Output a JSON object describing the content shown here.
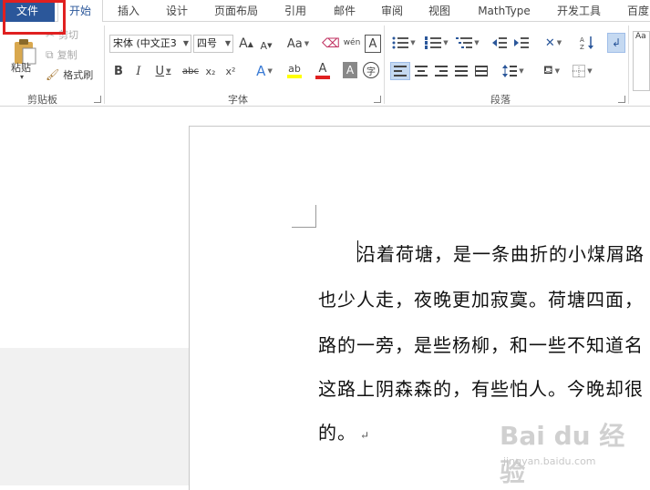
{
  "tabs": {
    "file": "文件",
    "home": "开始",
    "insert": "插入",
    "design": "设计",
    "layout": "页面布局",
    "references": "引用",
    "mailings": "邮件",
    "review": "审阅",
    "view": "视图",
    "mathtype": "MathType",
    "developer": "开发工具",
    "baidu": "百度"
  },
  "clipboard": {
    "paste": "粘贴",
    "cut": "剪切",
    "copy": "复制",
    "format_painter": "格式刷",
    "label": "剪贴板"
  },
  "font": {
    "font_name": "宋体 (中文正3",
    "font_size": "四号",
    "grow": "A",
    "shrink": "A",
    "change_case": "Aa",
    "phonetic": "wén",
    "border_char": "A",
    "bold": "B",
    "italic": "I",
    "underline": "U",
    "strike": "abc",
    "subscript": "x₂",
    "superscript": "x²",
    "effects": "A",
    "highlight": "ab",
    "font_color": "A",
    "shading": "A",
    "enclose": "字",
    "label": "字体"
  },
  "paragraph": {
    "label": "段落"
  },
  "styles": {
    "preview": "Aa"
  },
  "colors": {
    "file_tab": "#2b579a",
    "accent": "#2b579a",
    "highlight_bar": "#ffff00",
    "font_color_bar": "#e02020",
    "red_annotation": "#e02020"
  },
  "document": {
    "lines": [
      "沿着荷塘，是一条曲折的小煤屑路",
      "也少人走，夜晚更加寂寞。荷塘四面，",
      "路的一旁，是些杨柳，和一些不知道名",
      "这路上阴森森的，有些怕人。今晚却很",
      "的。"
    ],
    "para_mark": "↵"
  },
  "watermark": {
    "brand": "Bai du 经验",
    "url": "jingyan.baidu.com"
  }
}
